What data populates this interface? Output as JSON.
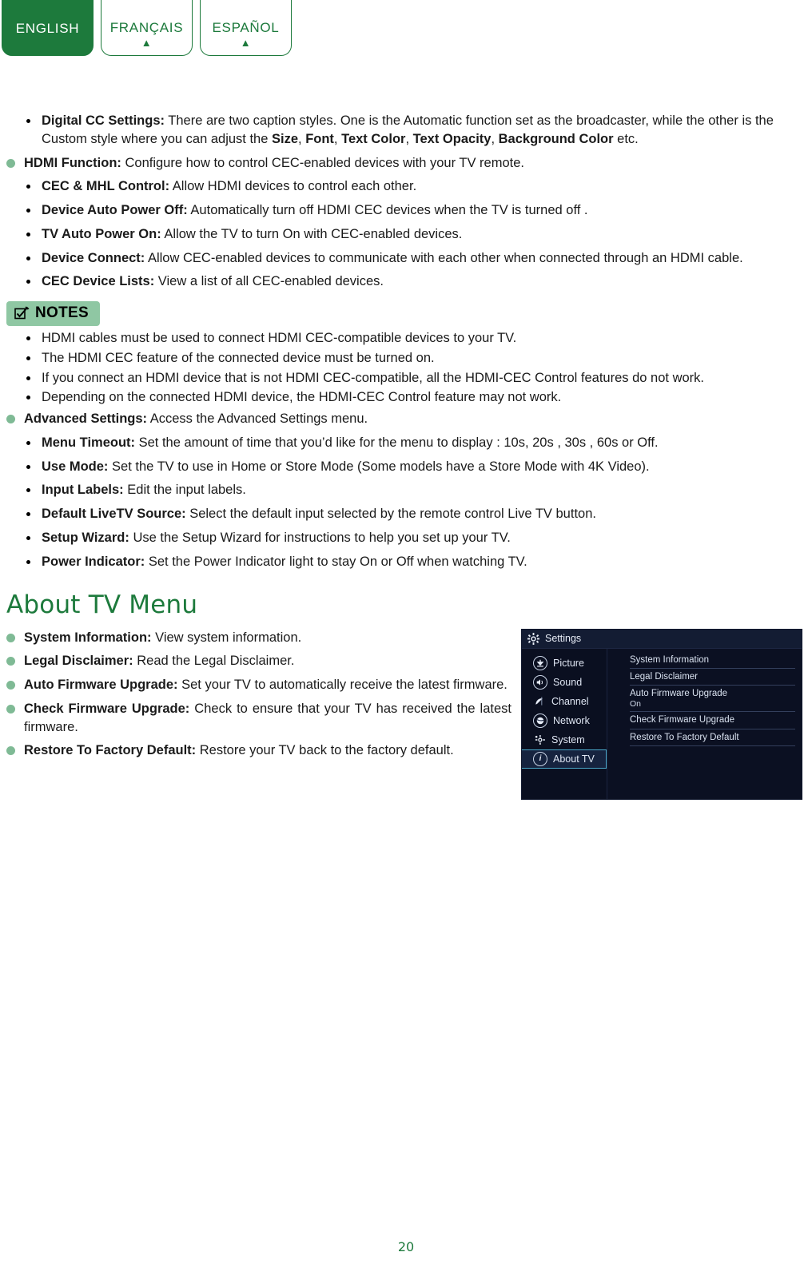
{
  "tabs": [
    {
      "label": "ENGLISH",
      "arrow": "▲",
      "active": true
    },
    {
      "label": "FRANÇAIS",
      "arrow": "▲",
      "active": false
    },
    {
      "label": "ESPAÑOL",
      "arrow": "▲",
      "active": false
    }
  ],
  "colors": {
    "brand_green": "#1d7a3c",
    "bullet_green": "#7fba95",
    "notes_badge_bg": "#8fc7a3",
    "tv_panel_bg": "#0b1022",
    "tv_highlight": "#16233f",
    "tv_highlight_border": "#4aa6c8"
  },
  "body_items": [
    {
      "level": 2,
      "term": "Digital CC Settings:",
      "desc": " There are two caption styles. One is the Automatic function set as the broadcaster, while the other is the Custom style where you can adjust the ",
      "bold_tail": [
        "Size",
        "Font",
        "Text Color",
        "Text Opacity",
        "Background Color"
      ],
      "tail": " etc."
    },
    {
      "level": 1,
      "term": "HDMI Function:",
      "desc": " Configure how to control CEC-enabled devices with your TV remote."
    },
    {
      "level": 2,
      "term": "CEC & MHL Control:",
      "desc": " Allow HDMI devices to control each other."
    },
    {
      "level": 2,
      "term": "Device Auto Power Off:",
      "desc": " Automatically turn off HDMI CEC devices when the TV is turned off ."
    },
    {
      "level": 2,
      "term": "TV Auto Power On:",
      "desc": " Allow the TV to turn On with CEC-enabled devices."
    },
    {
      "level": 2,
      "term": "Device Connect:",
      "desc": " Allow CEC-enabled devices to communicate with each other when connected through an HDMI cable."
    },
    {
      "level": 2,
      "term": "CEC Device Lists:",
      "desc": " View a list of all CEC-enabled devices."
    }
  ],
  "notes": {
    "badge_label": "NOTES",
    "badge_icon": "checkbox-pen-icon",
    "items": [
      "HDMI cables must be used to connect HDMI CEC-compatible devices to your TV.",
      "The HDMI CEC feature of the connected device must be turned on.",
      "If you connect an HDMI device that is not HDMI CEC-compatible, all the HDMI-CEC Control features do not work.",
      "Depending on the connected HDMI device, the HDMI-CEC Control feature may not work."
    ]
  },
  "advanced_items": [
    {
      "level": 1,
      "term": "Advanced Settings:",
      "desc": " Access the Advanced Settings menu."
    },
    {
      "level": 2,
      "term": "Menu Timeout:",
      "desc": " Set the amount of time that you’d like for the menu to display : 10s, 20s , 30s , 60s or Off."
    },
    {
      "level": 2,
      "term": "Use Mode:",
      "desc": " Set the TV to use in Home or Store Mode (Some models have a Store Mode with 4K Video)."
    },
    {
      "level": 2,
      "term": "Input Labels:",
      "desc": " Edit the input labels."
    },
    {
      "level": 2,
      "term": "Default LiveTV Source:",
      "desc": " Select the default input selected by the remote control Live TV button."
    },
    {
      "level": 2,
      "term": "Setup Wizard:",
      "desc": " Use the Setup Wizard for instructions to help you set up your TV."
    },
    {
      "level": 2,
      "term": "Power Indicator:",
      "desc": " Set the Power Indicator light to stay On or Off when watching TV."
    }
  ],
  "about_section": {
    "heading": "About TV Menu",
    "items": [
      {
        "term": "System Information:",
        "desc": " View system information."
      },
      {
        "term": "Legal Disclaimer:",
        "desc": " Read the Legal Disclaimer."
      },
      {
        "term": "Auto Firmware Upgrade:",
        "desc": " Set your TV to automatically receive the latest firmware."
      },
      {
        "term": "Check Firmware Upgrade:",
        "desc": " Check to ensure that your TV has received the latest firmware."
      },
      {
        "term": "Restore To Factory Default:",
        "desc": " Restore your TV back to the factory default."
      }
    ]
  },
  "tv_screenshot": {
    "title": "Settings",
    "title_icon": "gear-icon",
    "sidebar": [
      {
        "label": "Picture",
        "icon": "picture-icon",
        "selected": false
      },
      {
        "label": "Sound",
        "icon": "speaker-icon",
        "selected": false
      },
      {
        "label": "Channel",
        "icon": "satellite-dish-icon",
        "selected": false
      },
      {
        "label": "Network",
        "icon": "globe-icon",
        "selected": false
      },
      {
        "label": "System",
        "icon": "gear-icon",
        "selected": false
      },
      {
        "label": "About TV",
        "icon": "info-icon",
        "selected": true
      }
    ],
    "entries": [
      {
        "label": "System Information",
        "value": ""
      },
      {
        "label": "Legal Disclaimer",
        "value": ""
      },
      {
        "label": "Auto Firmware Upgrade",
        "value": "On"
      },
      {
        "label": "Check Firmware Upgrade",
        "value": ""
      },
      {
        "label": "Restore To Factory Default",
        "value": ""
      }
    ]
  },
  "page_number": "20"
}
